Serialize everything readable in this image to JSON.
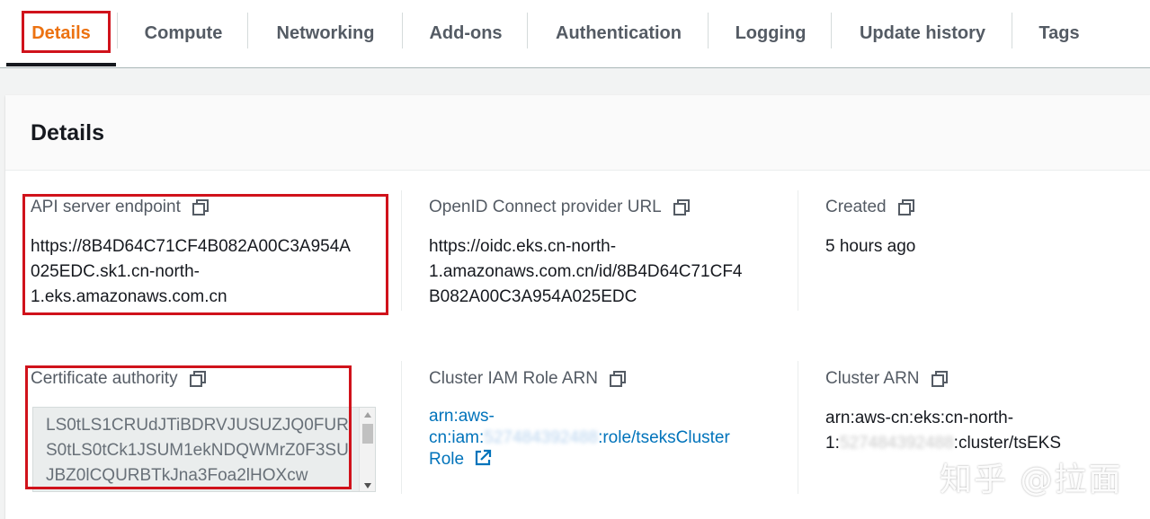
{
  "tabs": [
    {
      "label": "Details",
      "active": true
    },
    {
      "label": "Compute",
      "active": false
    },
    {
      "label": "Networking",
      "active": false
    },
    {
      "label": "Add-ons",
      "active": false
    },
    {
      "label": "Authentication",
      "active": false
    },
    {
      "label": "Logging",
      "active": false
    },
    {
      "label": "Update history",
      "active": false
    },
    {
      "label": "Tags",
      "active": false
    }
  ],
  "colors": {
    "active_tab": "#ec7211",
    "link": "#0073bb",
    "highlight_box": "#d0121b"
  },
  "panel": {
    "title": "Details",
    "fields": {
      "api_endpoint": {
        "label": "API server endpoint",
        "lines": [
          "https://8B4D64C71CF4B082A00C3A954A",
          "025EDC.sk1.cn-north-",
          "1.eks.amazonaws.com.cn"
        ]
      },
      "oidc": {
        "label": "OpenID Connect provider URL",
        "lines": [
          "https://oidc.eks.cn-north-",
          "1.amazonaws.com.cn/id/8B4D64C71CF4",
          "B082A00C3A954A025EDC"
        ]
      },
      "created": {
        "label": "Created",
        "value": "5 hours ago"
      },
      "certificate": {
        "label": "Certificate authority",
        "value": "LS0tLS1CRUdJTiBDRVJUSUZJQ0FURS0tLS0tCk1JSUM1ekNDQWMrZ0F3SUJBZ0lCQURBTkJna3Foa2lHOXcw"
      },
      "iam_role": {
        "label": "Cluster IAM Role ARN",
        "line1": "arn:aws-",
        "line2_prefix": "cn:iam:",
        "account_blurred": "527484392488",
        "line2_suffix": ":role/tseksCluster",
        "line3": "Role"
      },
      "cluster_arn": {
        "label": "Cluster ARN",
        "line1": "arn:aws-cn:eks:cn-north-",
        "line2_prefix": "1:",
        "account_blurred": "527484392488",
        "line2_suffix": ":cluster/tsEKS"
      }
    }
  },
  "watermark": "知乎 @拉面"
}
